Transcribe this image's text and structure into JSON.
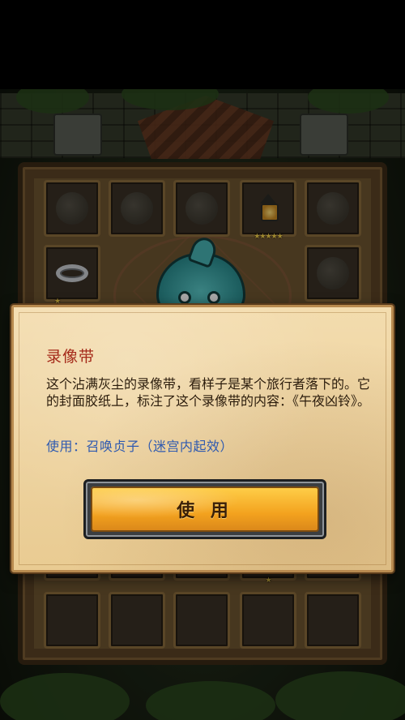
{
  "dialog": {
    "title": "录像带",
    "description": "这个沾满灰尘的录像带，看样子是某个旅行者落下的。它的封面胶纸上，标注了这个录像带的内容：《午夜凶铃》。",
    "usage": "使用：召唤贞子（迷宫内起效）",
    "use_button_label": "使 用"
  },
  "inventory": {
    "lamp_rating": "★★★★★",
    "ring_rating": "★",
    "lower_row_rating": "★"
  },
  "colors": {
    "title": "#a52a1a",
    "usage": "#2f5ab0",
    "button": "#f3a21e",
    "parchment": "#f3dcae"
  }
}
